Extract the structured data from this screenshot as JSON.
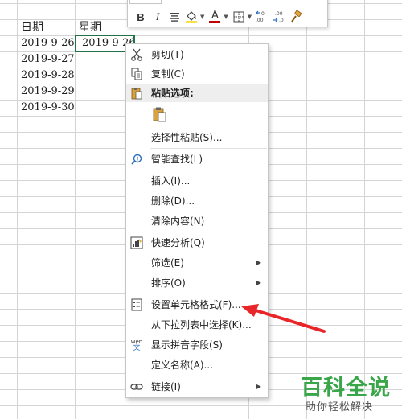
{
  "sheet": {
    "header_date": "日期",
    "header_weekday": "星期",
    "dates": [
      "2019-9-26",
      "2019-9-27",
      "2019-9-28",
      "2019-9-29",
      "2019-9-30"
    ],
    "selected_value": "2019-9-26",
    "selection_color": "#217346"
  },
  "mini_toolbar": {
    "bold": "B",
    "italic": "I",
    "font_color_glyph": "A",
    "font_color": "#c00000"
  },
  "context_menu": {
    "cut": "剪切(T)",
    "copy": "复制(C)",
    "paste_options": "粘贴选项:",
    "paste_special": "选择性粘贴(S)...",
    "smart_lookup": "智能查找(L)",
    "insert": "插入(I)...",
    "delete": "删除(D)...",
    "clear_contents": "清除内容(N)",
    "quick_analysis": "快速分析(Q)",
    "filter": "筛选(E)",
    "sort": "排序(O)",
    "format_cells": "设置单元格格式(F)...",
    "pick_from_list": "从下拉列表中选择(K)...",
    "show_phonetic": "显示拼音字段(S)",
    "define_name": "定义名称(A)...",
    "link": "链接(I)",
    "phonetic_icon_top": "wén",
    "phonetic_icon_bottom": "文"
  },
  "annotation_color": "#e8262a",
  "watermark": {
    "title": "百科全说",
    "subtitle": "助你轻松解决",
    "color": "#3aa64a"
  }
}
